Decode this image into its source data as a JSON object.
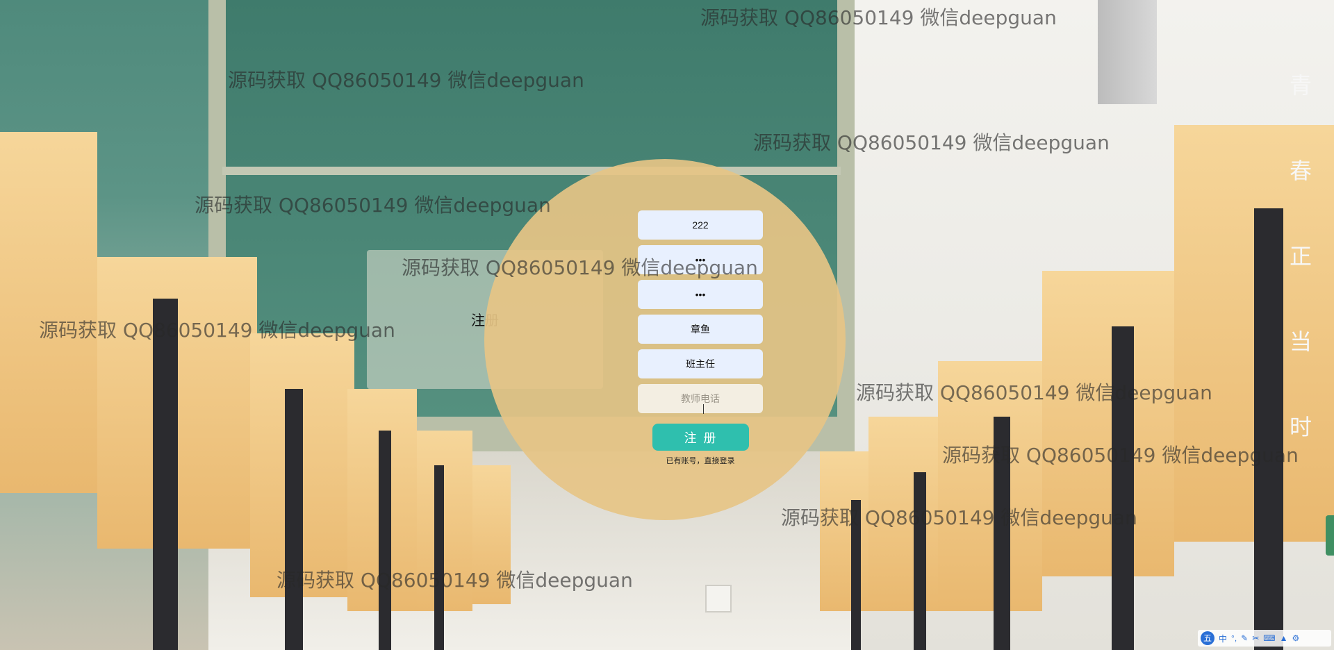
{
  "watermark_text": "源码获取 QQ86050149 微信deepguan",
  "slogan": [
    "青",
    "春",
    "正",
    "当",
    "时"
  ],
  "form": {
    "side_title": "注册",
    "fields": [
      {
        "name": "account",
        "value": "222",
        "masked": false
      },
      {
        "name": "password",
        "value": "•••",
        "masked": true
      },
      {
        "name": "confirm-password",
        "value": "•••",
        "masked": true
      },
      {
        "name": "teacher-name",
        "value": "章鱼",
        "masked": false
      },
      {
        "name": "position",
        "value": "班主任",
        "masked": false
      }
    ],
    "phone_placeholder": "教师电话",
    "submit_label": "注 册",
    "login_link": "已有账号，直接登录"
  },
  "ime": {
    "logo": "五",
    "mode": "中",
    "icons": [
      "punctuation-icon",
      "pen-icon",
      "scissors-icon",
      "keyboard-icon",
      "shirt-icon",
      "settings-icon"
    ]
  },
  "colors": {
    "circle": "#e6c485",
    "button": "#2fbfae",
    "field": "#e8f0fe"
  }
}
